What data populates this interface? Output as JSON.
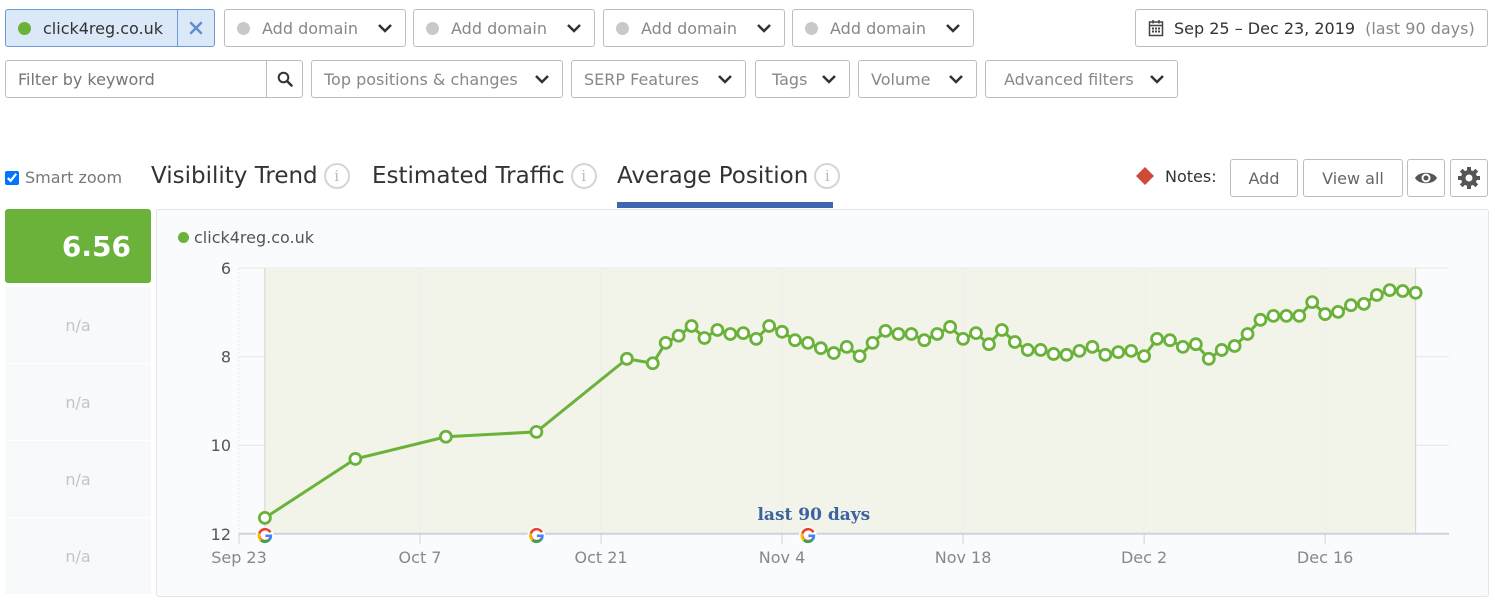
{
  "domains": {
    "active": {
      "label": "click4reg.co.uk",
      "color": "#6ab23a"
    },
    "placeholders": [
      "Add domain",
      "Add domain",
      "Add domain",
      "Add domain"
    ]
  },
  "date_range": {
    "label": "Sep 25 – Dec 23, 2019",
    "suffix": "(last 90 days)"
  },
  "filters": {
    "keyword_placeholder": "Filter by keyword",
    "dropdowns": [
      "Top positions & changes",
      "SERP Features",
      "Tags",
      "Volume",
      "Advanced filters"
    ]
  },
  "smart_zoom": {
    "label": "Smart zoom",
    "checked": true
  },
  "tabs": [
    {
      "label": "Visibility Trend",
      "active": false
    },
    {
      "label": "Estimated Traffic",
      "active": false
    },
    {
      "label": "Average Position",
      "active": true
    }
  ],
  "notes": {
    "label": "Notes:",
    "add": "Add",
    "view_all": "View all"
  },
  "summary": {
    "value": "6.56",
    "others": [
      "n/a",
      "n/a",
      "n/a",
      "n/a"
    ]
  },
  "colors": {
    "accent": "#6ab23a",
    "tab_underline": "#3f66b0",
    "note_marker": "#d04a3a",
    "annotation": "#3d62a0"
  },
  "chart_data": {
    "type": "line",
    "title": "Average Position",
    "legend": [
      {
        "name": "click4reg.co.uk",
        "color": "#6ab23a"
      }
    ],
    "legend_placement": "top-left",
    "ylabel": "",
    "xlabel": "",
    "y_inverted": true,
    "ylim": [
      6,
      12
    ],
    "yticks": [
      6,
      8,
      10,
      12
    ],
    "xlim": [
      "2019-09-23",
      "2019-12-29"
    ],
    "xticks": [
      {
        "date": "2019-09-23",
        "label": "Sep 23"
      },
      {
        "date": "2019-10-07",
        "label": "Oct 7"
      },
      {
        "date": "2019-10-21",
        "label": "Oct 21"
      },
      {
        "date": "2019-11-04",
        "label": "Nov 4"
      },
      {
        "date": "2019-11-18",
        "label": "Nov 18"
      },
      {
        "date": "2019-12-02",
        "label": "Dec 2"
      },
      {
        "date": "2019-12-16",
        "label": "Dec 16"
      }
    ],
    "range_band": {
      "start": "2019-09-25",
      "end": "2019-12-23",
      "label": "last 90 days"
    },
    "google_markers": [
      "2019-09-25",
      "2019-10-16",
      "2019-11-06"
    ],
    "grid": true,
    "series": [
      {
        "name": "click4reg.co.uk",
        "points": [
          [
            "2019-09-25",
            11.64
          ],
          [
            "2019-10-02",
            10.31
          ],
          [
            "2019-10-09",
            9.81
          ],
          [
            "2019-10-16",
            9.7
          ],
          [
            "2019-10-23",
            8.05
          ],
          [
            "2019-10-25",
            8.15
          ],
          [
            "2019-10-26",
            7.69
          ],
          [
            "2019-10-27",
            7.53
          ],
          [
            "2019-10-28",
            7.31
          ],
          [
            "2019-10-29",
            7.58
          ],
          [
            "2019-10-30",
            7.4
          ],
          [
            "2019-10-31",
            7.49
          ],
          [
            "2019-11-01",
            7.47
          ],
          [
            "2019-11-02",
            7.6
          ],
          [
            "2019-11-03",
            7.31
          ],
          [
            "2019-11-04",
            7.44
          ],
          [
            "2019-11-05",
            7.63
          ],
          [
            "2019-11-06",
            7.69
          ],
          [
            "2019-11-07",
            7.81
          ],
          [
            "2019-11-08",
            7.92
          ],
          [
            "2019-11-09",
            7.78
          ],
          [
            "2019-11-10",
            7.99
          ],
          [
            "2019-11-11",
            7.69
          ],
          [
            "2019-11-12",
            7.42
          ],
          [
            "2019-11-13",
            7.49
          ],
          [
            "2019-11-14",
            7.49
          ],
          [
            "2019-11-15",
            7.63
          ],
          [
            "2019-11-16",
            7.49
          ],
          [
            "2019-11-17",
            7.33
          ],
          [
            "2019-11-18",
            7.6
          ],
          [
            "2019-11-19",
            7.47
          ],
          [
            "2019-11-20",
            7.72
          ],
          [
            "2019-11-21",
            7.4
          ],
          [
            "2019-11-22",
            7.67
          ],
          [
            "2019-11-23",
            7.85
          ],
          [
            "2019-11-24",
            7.85
          ],
          [
            "2019-11-25",
            7.94
          ],
          [
            "2019-11-26",
            7.96
          ],
          [
            "2019-11-27",
            7.87
          ],
          [
            "2019-11-28",
            7.78
          ],
          [
            "2019-11-29",
            7.96
          ],
          [
            "2019-11-30",
            7.9
          ],
          [
            "2019-12-01",
            7.87
          ],
          [
            "2019-12-02",
            7.99
          ],
          [
            "2019-12-03",
            7.6
          ],
          [
            "2019-12-04",
            7.63
          ],
          [
            "2019-12-05",
            7.78
          ],
          [
            "2019-12-06",
            7.72
          ],
          [
            "2019-12-07",
            8.05
          ],
          [
            "2019-12-08",
            7.85
          ],
          [
            "2019-12-09",
            7.76
          ],
          [
            "2019-12-10",
            7.49
          ],
          [
            "2019-12-11",
            7.17
          ],
          [
            "2019-12-12",
            7.08
          ],
          [
            "2019-12-13",
            7.08
          ],
          [
            "2019-12-14",
            7.08
          ],
          [
            "2019-12-15",
            6.77
          ],
          [
            "2019-12-16",
            7.04
          ],
          [
            "2019-12-17",
            6.99
          ],
          [
            "2019-12-18",
            6.84
          ],
          [
            "2019-12-19",
            6.81
          ],
          [
            "2019-12-20",
            6.61
          ],
          [
            "2019-12-21",
            6.5
          ],
          [
            "2019-12-22",
            6.52
          ],
          [
            "2019-12-23",
            6.56
          ]
        ]
      }
    ]
  }
}
